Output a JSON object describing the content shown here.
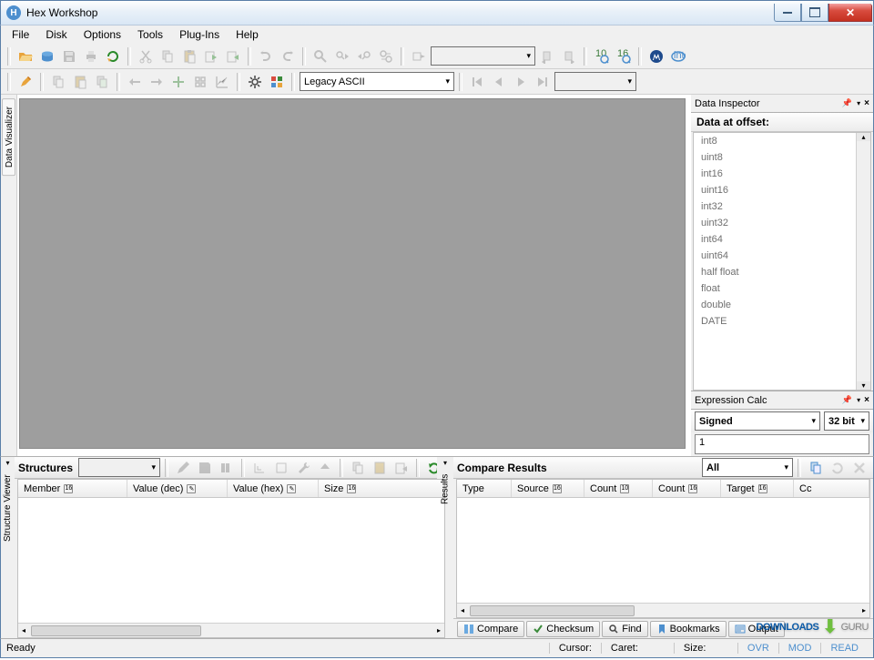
{
  "window": {
    "title": "Hex Workshop"
  },
  "menu": [
    "File",
    "Disk",
    "Options",
    "Tools",
    "Plug-Ins",
    "Help"
  ],
  "toolbar2": {
    "encoding": "Legacy ASCII"
  },
  "sidebar_left": {
    "tab": "Data Visualizer"
  },
  "data_inspector": {
    "pane_title": "Data Inspector",
    "header": "Data at offset:",
    "types": [
      "int8",
      "uint8",
      "int16",
      "uint16",
      "int32",
      "uint32",
      "int64",
      "uint64",
      "half float",
      "float",
      "double",
      "DATE"
    ]
  },
  "expr_calc": {
    "pane_title": "Expression Calc",
    "sign": "Signed",
    "bits": "32 bit",
    "value": "1"
  },
  "structures": {
    "pane_title": "Structures",
    "side_label": "Structure Viewer",
    "columns": [
      {
        "label": "Member",
        "badge": "16"
      },
      {
        "label": "Value (dec)",
        "badge": "✎"
      },
      {
        "label": "Value (hex)",
        "badge": "✎"
      },
      {
        "label": "Size",
        "badge": "16"
      }
    ]
  },
  "compare": {
    "pane_title": "Compare Results",
    "side_label": "Results",
    "filter": "All",
    "columns": [
      {
        "label": "Type",
        "badge": ""
      },
      {
        "label": "Source",
        "badge": "16"
      },
      {
        "label": "Count",
        "badge": "10"
      },
      {
        "label": "Count",
        "badge": "16"
      },
      {
        "label": "Target",
        "badge": "16"
      },
      {
        "label": "Cc",
        "badge": ""
      }
    ],
    "tabs": [
      "Compare",
      "Checksum",
      "Find",
      "Bookmarks",
      "Output"
    ]
  },
  "status": {
    "ready": "Ready",
    "cursor_label": "Cursor:",
    "caret_label": "Caret:",
    "size_label": "Size:",
    "ovr": "OVR",
    "mod": "MOD",
    "read": "READ"
  },
  "watermark": {
    "a": "DOWNLOADS",
    "b": "GURU"
  }
}
